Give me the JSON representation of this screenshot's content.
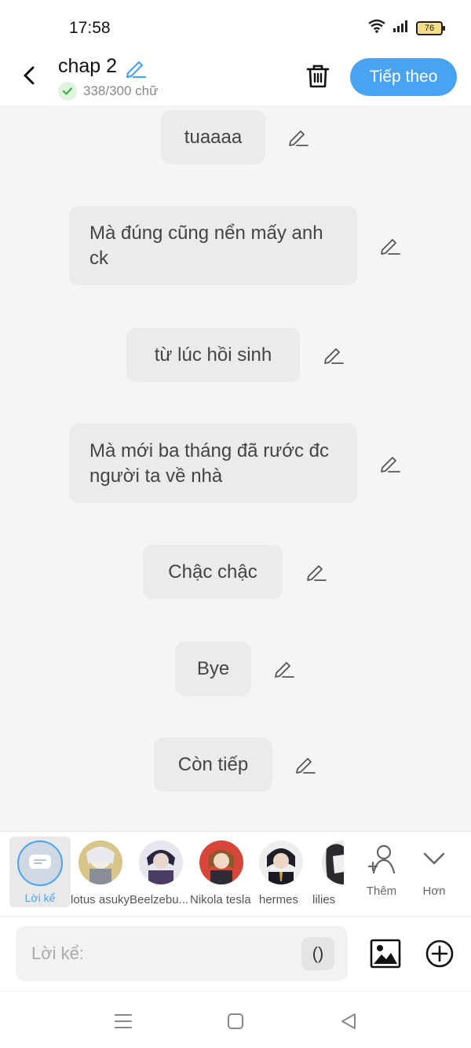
{
  "status": {
    "time": "17:58",
    "battery": "76"
  },
  "header": {
    "title": "chap 2",
    "word_count": "338/300 chữ",
    "next_label": "Tiếp theo"
  },
  "messages": [
    {
      "text": "tuaaaa"
    },
    {
      "text": "Mà đúng cũng nển mấy anh ck"
    },
    {
      "text": "từ lúc hồi sinh"
    },
    {
      "text": "Mà mới ba tháng đã rước đc người ta về nhà"
    },
    {
      "text": "Chậc chậc"
    },
    {
      "text": "Bye"
    },
    {
      "text": "Còn tiếp"
    }
  ],
  "characters": {
    "narrator": "Lời kể",
    "list": [
      {
        "name": "lotus asuky"
      },
      {
        "name": "Beelzebu..."
      },
      {
        "name": "Nikola tesla"
      },
      {
        "name": "hermes"
      },
      {
        "name": "lilies"
      }
    ],
    "add_label": "Thêm",
    "more_label": "Hơn"
  },
  "input": {
    "placeholder": "Lời kể:",
    "paren_label": "()"
  },
  "colors": {
    "accent": "#4aa3f0",
    "chat_bg": "#f5f5f5",
    "bubble_bg": "#ebebeb"
  },
  "icons": [
    "back-icon",
    "edit-icon",
    "check-icon",
    "trash-icon",
    "image-icon",
    "plus-circle-icon",
    "add-person-icon",
    "chevron-down-icon",
    "menu-icon",
    "home-icon",
    "back-triangle-icon"
  ]
}
